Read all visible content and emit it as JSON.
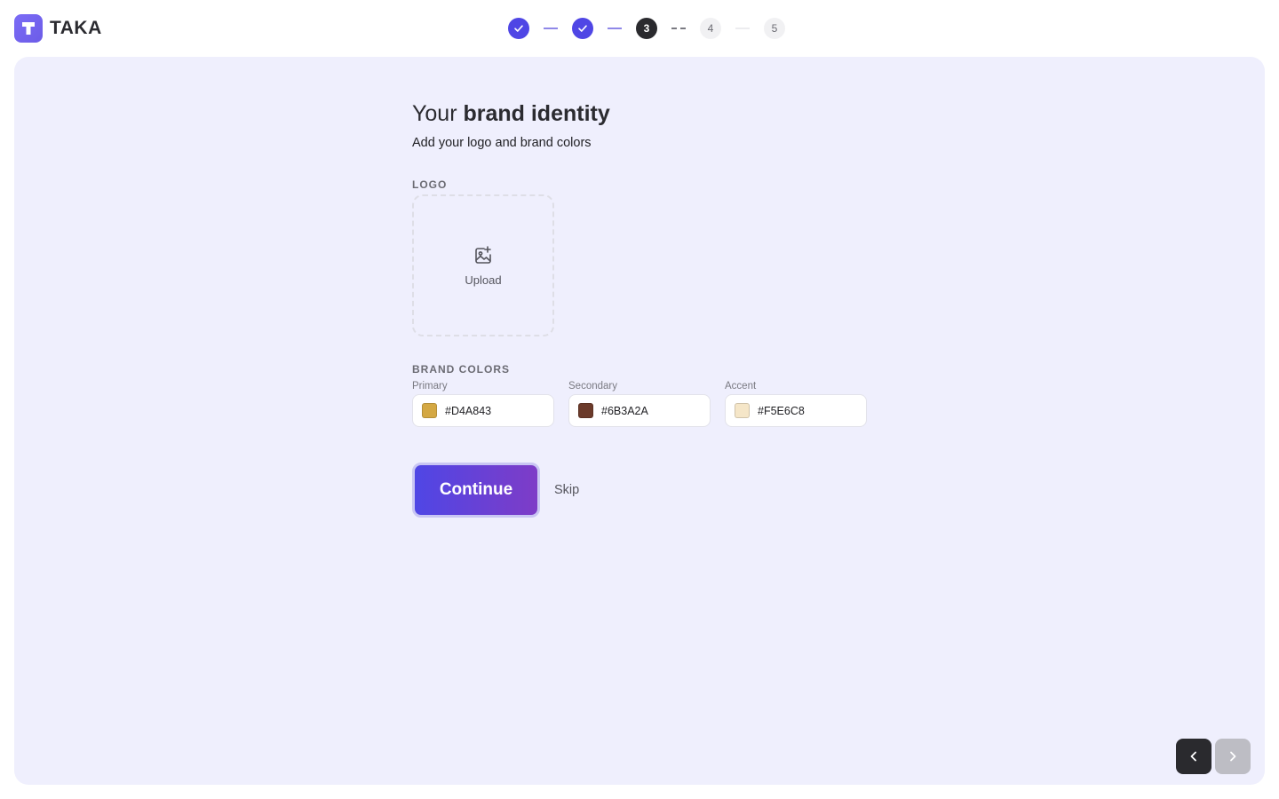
{
  "app": {
    "name": "TAKA",
    "logo_icon": "t-logo-icon",
    "accent": "#4f46e5"
  },
  "stepper": {
    "current": 3,
    "steps": [
      {
        "label": "",
        "state": "done"
      },
      {
        "label": "",
        "state": "done"
      },
      {
        "label": "3",
        "state": "current"
      },
      {
        "label": "4",
        "state": "todo"
      },
      {
        "label": "5",
        "state": "todo"
      }
    ]
  },
  "page": {
    "title_prefix": "Your ",
    "title_bold": "brand identity",
    "subtitle": "Add your logo and brand colors"
  },
  "logo_section": {
    "label": "LOGO",
    "upload_label": "Upload",
    "upload_icon": "image-add-icon"
  },
  "colors_section": {
    "label": "BRAND COLORS",
    "fields": [
      {
        "name": "Primary",
        "value": "#D4A843",
        "swatch": "#D4A843"
      },
      {
        "name": "Secondary",
        "value": "#6B3A2A",
        "swatch": "#6B3A2A"
      },
      {
        "name": "Accent",
        "value": "#F5E6C8",
        "swatch": "#F5E6C8"
      }
    ]
  },
  "actions": {
    "continue_label": "Continue",
    "skip_label": "Skip"
  },
  "navigation": {
    "prev_icon": "chevron-left-icon",
    "next_icon": "chevron-right-icon"
  }
}
